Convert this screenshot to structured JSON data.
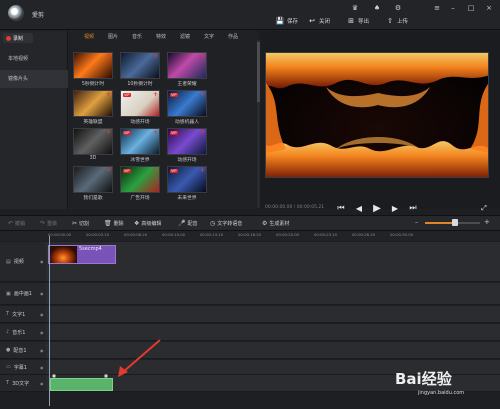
{
  "app": {
    "title": "愛剪"
  },
  "topbar": {
    "save": "保存",
    "close": "关闭",
    "export": "导出",
    "upload": "上传"
  },
  "left_panel": {
    "record": "录制",
    "items": [
      "本地视频",
      "镜像片头"
    ]
  },
  "asset_tabs": [
    "视频",
    "图片",
    "音乐",
    "特效",
    "滤镜",
    "文字",
    "作品"
  ],
  "assets": [
    {
      "label": "5秒倒计时",
      "vip": false
    },
    {
      "label": "10秒倒计时",
      "vip": false
    },
    {
      "label": "王者荣耀",
      "vip": false
    },
    {
      "label": "英雄联盟",
      "vip": false
    },
    {
      "label": "动感开场",
      "vip": true
    },
    {
      "label": "动感机器人",
      "vip": true
    },
    {
      "label": "3D",
      "vip": false
    },
    {
      "label": "冰雪世界",
      "vip": true
    },
    {
      "label": "动感开场",
      "vip": true
    },
    {
      "label": "我们是歌",
      "vip": false
    },
    {
      "label": "广告开场",
      "vip": true
    },
    {
      "label": "未来世界",
      "vip": true
    }
  ],
  "preview": {
    "timecode": "00:00:00.00 / 00:00:05.21"
  },
  "toolbar": {
    "undo": "撤销",
    "redo": "重做",
    "cut": "切割",
    "delete": "删除",
    "advanced_edit": "高级编辑",
    "dub": "配音",
    "tts": "文字转语音",
    "generate": "生成素材"
  },
  "ruler_ticks": [
    "00:00:00.00",
    "00:00:03.10",
    "00:00:06.20",
    "00:00:10.00",
    "00:00:13.10",
    "00:00:16.20",
    "00:00:20.00",
    "00:00:23.10",
    "00:00:26.20",
    "00:00:30.00"
  ],
  "tracks": [
    {
      "label": "视频",
      "icon": "film-icon"
    },
    {
      "label": "画中画1",
      "icon": "pip-icon"
    },
    {
      "label": "文字1",
      "icon": "text-icon"
    },
    {
      "label": "音乐1",
      "icon": "music-icon"
    },
    {
      "label": "配音1",
      "icon": "mic-icon"
    },
    {
      "label": "字幕1",
      "icon": "subtitle-icon"
    },
    {
      "label": "3D文字",
      "icon": "text3d-icon"
    }
  ],
  "video_clip": {
    "label": "5secmp4"
  },
  "watermark": {
    "brand": "Bai经验",
    "url": "jingyan.baidu.com"
  },
  "colors": {
    "accent": "#e0852a",
    "record": "#e23a2e",
    "video_clip": "#7a52b8",
    "text3d_clip": "#5ab36b",
    "arrow": "#e23a2e"
  }
}
